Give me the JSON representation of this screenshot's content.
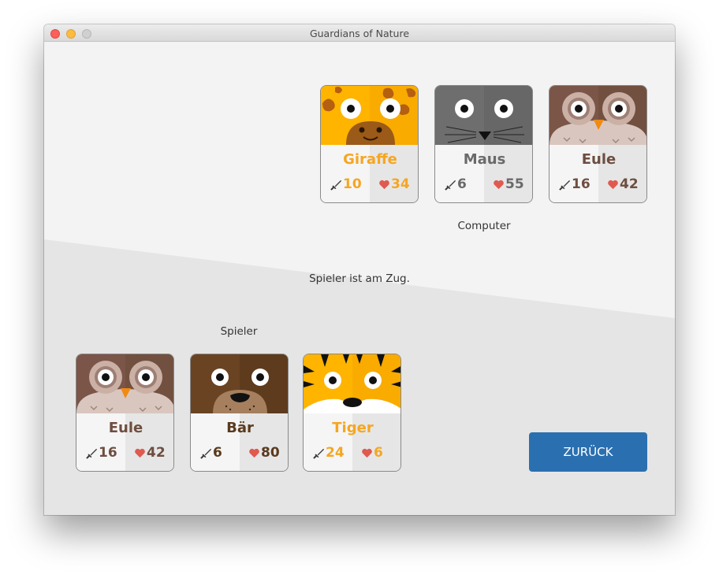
{
  "window": {
    "title": "Guardians of Nature"
  },
  "labels": {
    "computer": "Computer",
    "status": "Spieler ist am Zug.",
    "player": "Spieler"
  },
  "back_button": "ZURÜCK",
  "computer_cards": [
    {
      "name": "Giraffe",
      "animal": "giraffe",
      "attack": "10",
      "health": "34",
      "accent": "#f5a623"
    },
    {
      "name": "Maus",
      "animal": "mouse",
      "attack": "6",
      "health": "55",
      "accent": "#6a6a6a"
    },
    {
      "name": "Eule",
      "animal": "owl",
      "attack": "16",
      "health": "42",
      "accent": "#6e4e40"
    }
  ],
  "player_cards": [
    {
      "name": "Eule",
      "animal": "owl",
      "attack": "16",
      "health": "42",
      "accent": "#6e4e40"
    },
    {
      "name": "Bär",
      "animal": "bear",
      "attack": "6",
      "health": "80",
      "accent": "#5a3a1e"
    },
    {
      "name": "Tiger",
      "animal": "tiger",
      "attack": "24",
      "health": "6",
      "accent": "#f5a623"
    }
  ],
  "icons": {
    "attack": "sword-icon",
    "health": "heart-icon"
  },
  "colors": {
    "button": "#2a70b0",
    "heart": "#e05a4f",
    "sword": "#3a3a3a"
  }
}
